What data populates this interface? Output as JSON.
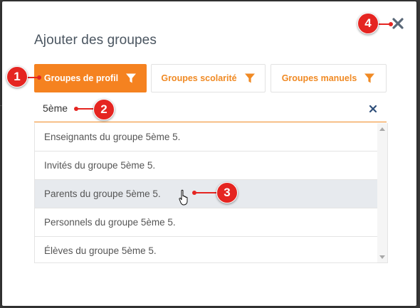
{
  "dialog": {
    "title": "Ajouter des groupes"
  },
  "tabs": [
    {
      "label": "Groupes de profil",
      "active": true
    },
    {
      "label": "Groupes scolarité",
      "active": false
    },
    {
      "label": "Groupes manuels",
      "active": false
    }
  ],
  "search": {
    "value": "5ème"
  },
  "results": [
    {
      "label": "Enseignants du groupe 5ème 5."
    },
    {
      "label": "Invités du groupe 5ème 5."
    },
    {
      "label": "Parents du groupe 5ème 5.",
      "hovered": true
    },
    {
      "label": "Personnels du groupe 5ème 5."
    },
    {
      "label": "Élèves du groupe 5ème 5."
    }
  ],
  "annotations": [
    "1",
    "2",
    "3",
    "4"
  ],
  "icons": {
    "close": "close-icon",
    "filter": "filter-icon",
    "clear": "clear-search-icon",
    "cursor": "hand-pointer-icon"
  },
  "colors": {
    "accent": "#f58220",
    "accent_text": "#f08a24",
    "annotation": "#e52521",
    "hover_row": "#e7eaee",
    "title": "#4a5560"
  }
}
